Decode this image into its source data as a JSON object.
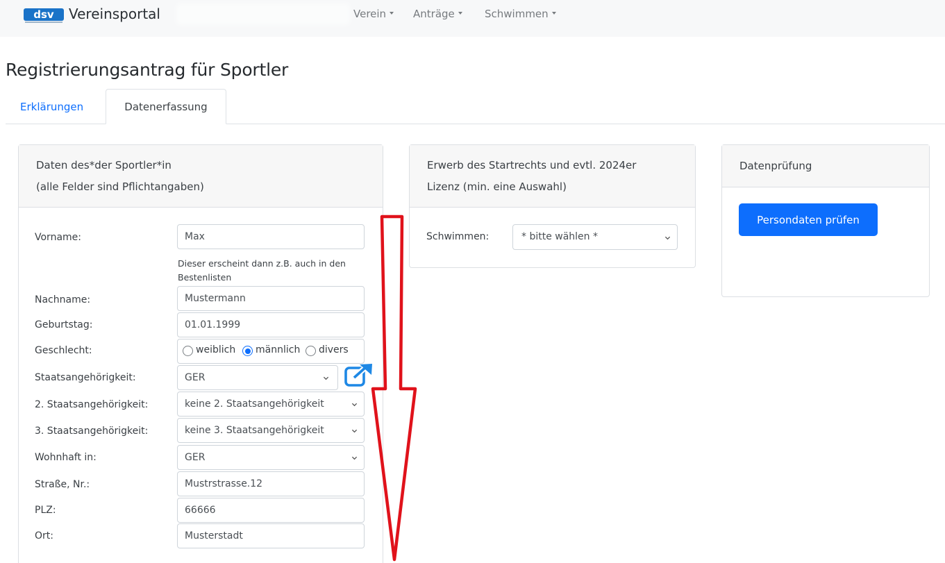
{
  "navbar": {
    "brand_logo_text": "dsv",
    "brand": "Vereinsportal",
    "menus": [
      "Verein",
      "Anträge",
      "Schwimmen"
    ]
  },
  "page": {
    "title": "Registrierungsantrag für Sportler"
  },
  "tabs": [
    {
      "label": "Erklärungen",
      "active": false
    },
    {
      "label": "Datenerfassung",
      "active": true
    }
  ],
  "athlete_card": {
    "header_line1": "Daten des*der Sportler*in",
    "header_line2": "(alle Felder sind Pflichtangaben)",
    "first_name": {
      "label": "Vorname:",
      "value": "Max"
    },
    "first_name_hint": "Dieser erscheint dann z.B. auch in den Bestenlisten",
    "last_name": {
      "label": "Nachname:",
      "value": "Mustermann"
    },
    "birthday": {
      "label": "Geburtstag:",
      "value": "01.01.1999"
    },
    "gender": {
      "label": "Geschlecht:",
      "options": [
        "weiblich",
        "männlich",
        "divers"
      ],
      "selected": "männlich"
    },
    "nationality": {
      "label": "Staatsangehörigkeit:",
      "value": "GER"
    },
    "nationality2": {
      "label": "2. Staatsangehörigkeit:",
      "value": "keine 2. Staatsangehörigkeit"
    },
    "nationality3": {
      "label": "3. Staatsangehörigkeit:",
      "value": "keine 3. Staatsangehörigkeit"
    },
    "residence": {
      "label": "Wohnhaft in:",
      "value": "GER"
    },
    "street": {
      "label": "Straße, Nr.:",
      "value": "Mustrstrasse.12"
    },
    "zip": {
      "label": "PLZ:",
      "value": "66666"
    },
    "city": {
      "label": "Ort:",
      "value": "Musterstadt"
    }
  },
  "license_card": {
    "header_line1": "Erwerb des Startrechts und evtl. 2024er",
    "header_line2": "Lizenz (min. eine Auswahl)",
    "swim": {
      "label": "Schwimmen:",
      "value": "* bitte wählen *"
    }
  },
  "check_card": {
    "header": "Datenprüfung",
    "button": "Persondaten prüfen"
  },
  "colors": {
    "primary": "#0d6efd",
    "annotation_arrow": "#e0121b",
    "navbar_bg": "#f7f8f9"
  }
}
